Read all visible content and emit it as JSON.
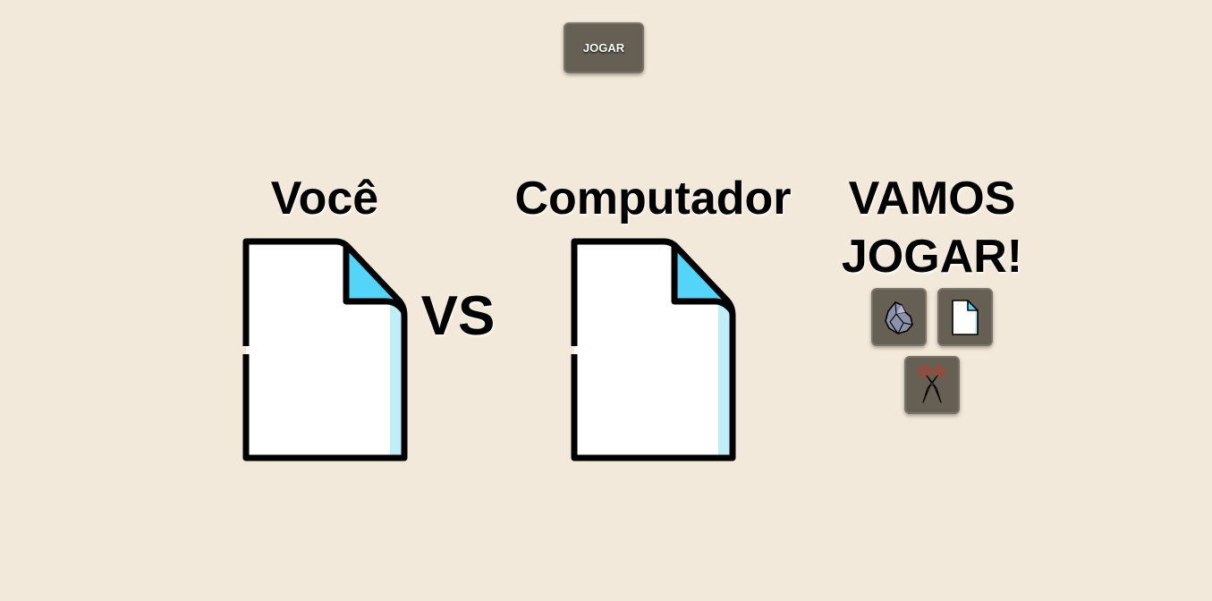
{
  "top_button": {
    "label": "JOGAR"
  },
  "scoreboard": {
    "player_label": "Você",
    "vs_label": "VS",
    "computer_label": "Computador",
    "player_choice_icon": "paper-file-icon",
    "computer_choice_icon": "paper-file-icon"
  },
  "picker": {
    "title": "VAMOS JOGAR!",
    "options": [
      {
        "name": "Pedra",
        "icon": "rock-icon"
      },
      {
        "name": "Papel",
        "icon": "paper-file-icon"
      },
      {
        "name": "Tesoura",
        "icon": "scissors-icon"
      }
    ]
  },
  "colors": {
    "background": "#f2e9da",
    "button_bg": "#665f54",
    "paper_fold": "#55d4f9",
    "paper_shade": "#bfeef8",
    "rock": "#8d92ac",
    "scissors_handle": "#c0392b"
  }
}
